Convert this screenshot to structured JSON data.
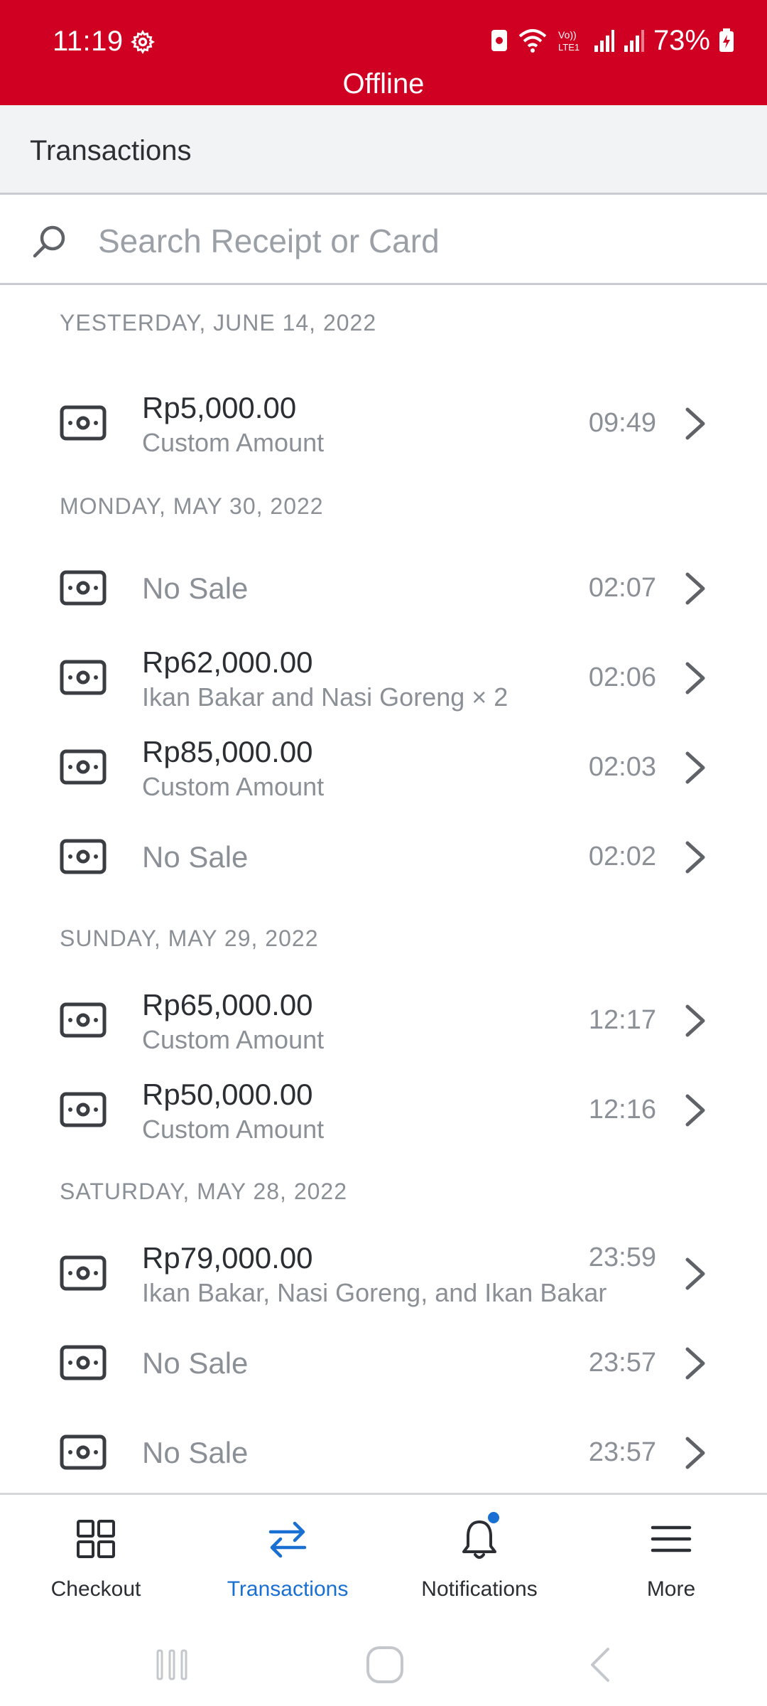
{
  "status_bar": {
    "time": "11:19",
    "battery": "73%",
    "network_label": "Offline"
  },
  "header": {
    "title": "Transactions"
  },
  "search": {
    "placeholder": "Search Receipt or Card",
    "value": ""
  },
  "sections": [
    {
      "date": "YESTERDAY, JUNE 14, 2022",
      "items": [
        {
          "amount": "Rp5,000.00",
          "desc": "Custom Amount",
          "time": "09:49"
        }
      ]
    },
    {
      "date": "MONDAY, MAY 30, 2022",
      "items": [
        {
          "no_sale": "No Sale",
          "time": "02:07"
        },
        {
          "amount": "Rp62,000.00",
          "desc": "Ikan Bakar and Nasi Goreng × 2",
          "time": "02:06"
        },
        {
          "amount": "Rp85,000.00",
          "desc": "Custom Amount",
          "time": "02:03"
        },
        {
          "no_sale": "No Sale",
          "time": "02:02"
        }
      ]
    },
    {
      "date": "SUNDAY, MAY 29, 2022",
      "items": [
        {
          "amount": "Rp65,000.00",
          "desc": "Custom Amount",
          "time": "12:17"
        },
        {
          "amount": "Rp50,000.00",
          "desc": "Custom Amount",
          "time": "12:16"
        }
      ]
    },
    {
      "date": "SATURDAY, MAY 28, 2022",
      "items": [
        {
          "amount": "Rp79,000.00",
          "desc": "Ikan Bakar, Nasi Goreng, and Ikan Bakar",
          "time": "23:59"
        },
        {
          "no_sale": "No Sale",
          "time": "23:57"
        },
        {
          "no_sale": "No Sale",
          "time": "23:57"
        }
      ]
    }
  ],
  "tabs": [
    {
      "label": "Checkout",
      "icon": "grid-icon"
    },
    {
      "label": "Transactions",
      "icon": "swap-arrows-icon",
      "active": true
    },
    {
      "label": "Notifications",
      "icon": "bell-icon",
      "badge": true
    },
    {
      "label": "More",
      "icon": "hamburger-menu-icon"
    }
  ],
  "colors": {
    "status_bar_bg": "#cf0021",
    "accent": "#1a6fd3"
  }
}
